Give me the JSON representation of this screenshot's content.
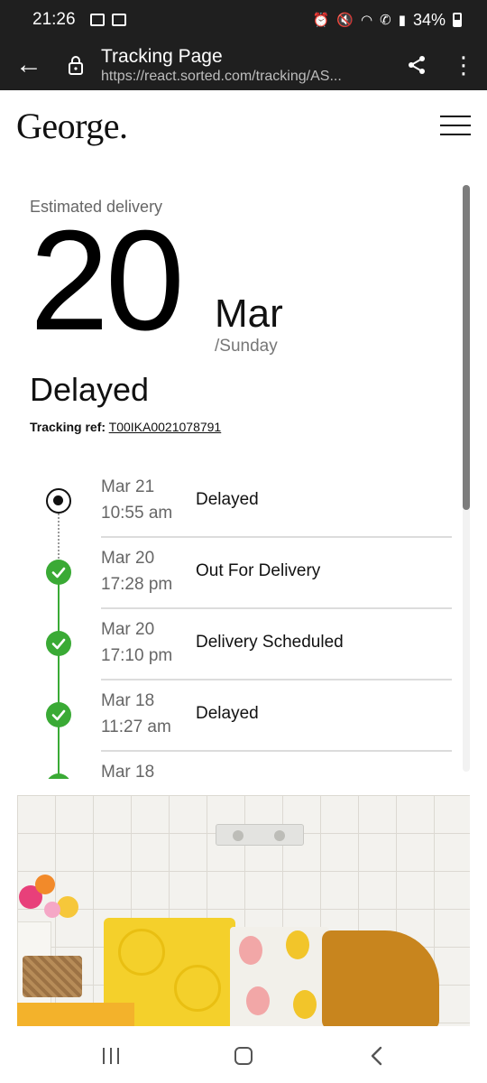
{
  "status_bar": {
    "time": "21:26",
    "battery": "34%",
    "icons": [
      "gallery-icon",
      "voicemail-icon",
      "alarm-icon",
      "mute-icon",
      "wifi-icon",
      "wifi-call-icon",
      "signal-icon",
      "battery-icon"
    ]
  },
  "browser": {
    "title": "Tracking Page",
    "url": "https://react.sorted.com/tracking/AS...",
    "icons": [
      "back-arrow-icon",
      "lock-icon",
      "share-icon",
      "overflow-menu-icon"
    ]
  },
  "site": {
    "logo_text": "George",
    "logo_dot": "."
  },
  "tracking": {
    "estimated_label": "Estimated delivery",
    "day": "20",
    "month": "Mar",
    "weekday": "/Sunday",
    "status": "Delayed",
    "ref_label": "Tracking ref:",
    "ref_value": "T00IKA0021078791",
    "events": [
      {
        "date": "Mar 21",
        "time": "10:55 am",
        "status": "Delayed",
        "state": "current"
      },
      {
        "date": "Mar 20",
        "time": "17:28 pm",
        "status": "Out For Delivery",
        "state": "done"
      },
      {
        "date": "Mar 20",
        "time": "17:10 pm",
        "status": "Delivery Scheduled",
        "state": "done"
      },
      {
        "date": "Mar 18",
        "time": "11:27 am",
        "status": "Delayed",
        "state": "done"
      },
      {
        "date": "Mar 18",
        "time": "",
        "status": "",
        "state": "done"
      }
    ]
  },
  "colors": {
    "success": "#3aaa35",
    "system_bar": "#1f1f1f"
  },
  "nav": {
    "icons": [
      "recent-apps-icon",
      "home-icon",
      "back-icon"
    ]
  }
}
